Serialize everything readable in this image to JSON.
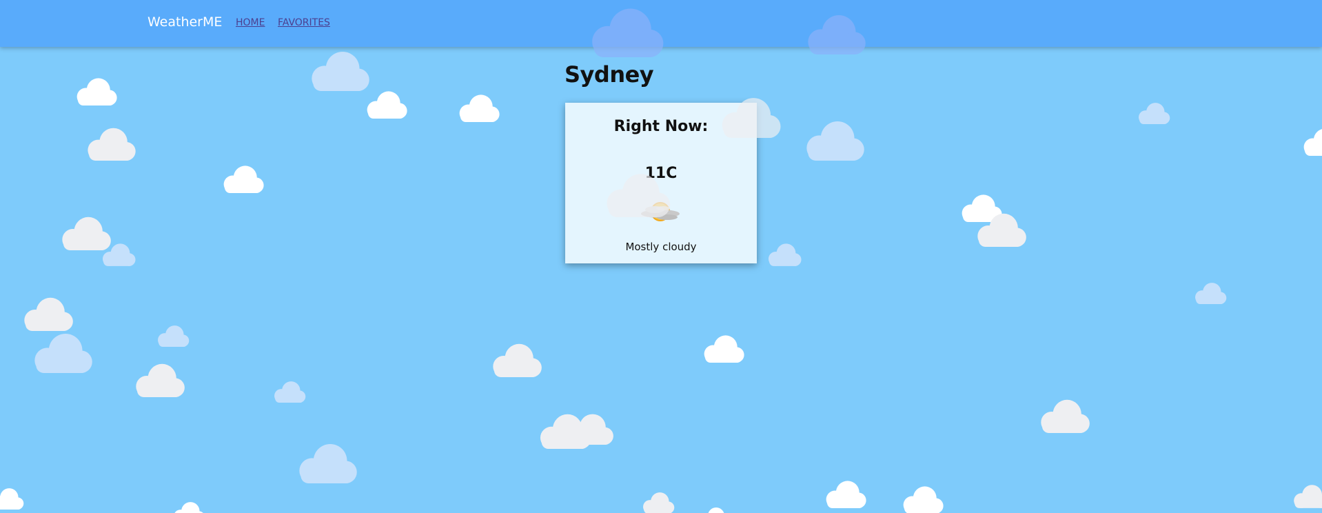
{
  "nav": {
    "brand": "WeatherME",
    "links": [
      "HOME",
      "FAVORITES"
    ]
  },
  "city": "Sydney",
  "current": {
    "heading": "Right Now:",
    "temperature": "11C",
    "condition": "Mostly cloudy",
    "icon": "partly-cloudy-icon"
  },
  "colors": {
    "background": "#7ecbfb",
    "navbar": "#59abfb",
    "link": "#4b3f8f"
  }
}
